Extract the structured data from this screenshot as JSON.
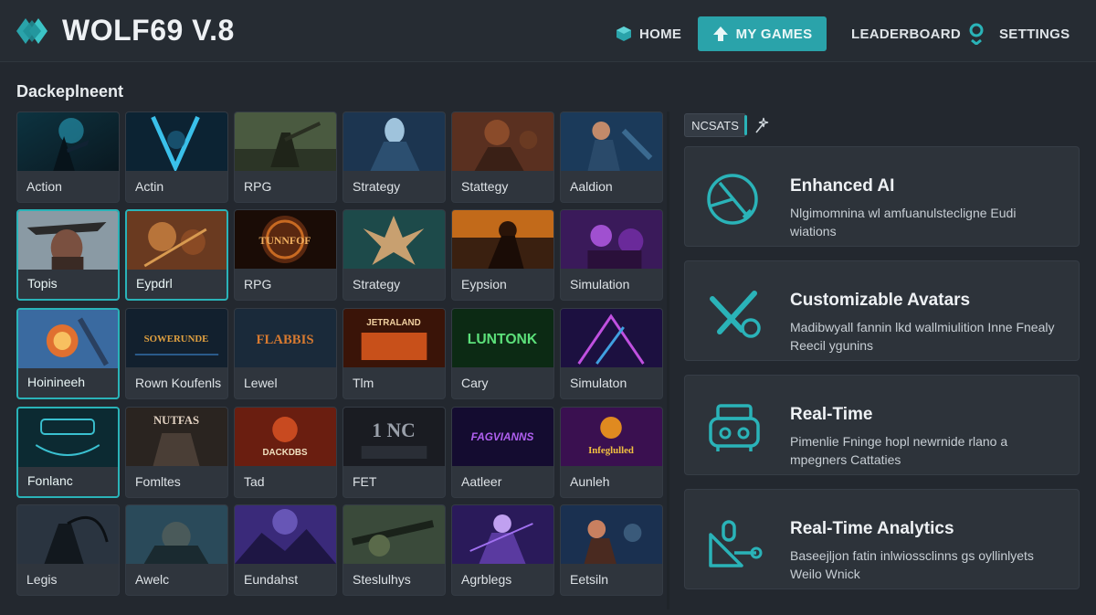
{
  "app": {
    "title": "WOLF69 V.8",
    "accent_color": "#2aa3aa",
    "logo_icon": "diamond-logo-icon"
  },
  "nav": {
    "home": {
      "label": "HOME",
      "icon": "home-box-icon"
    },
    "my_games": {
      "label": "MY GAMES",
      "icon": "arrow-up-icon",
      "active": true
    },
    "leaderboard": {
      "label": "LEADERBOARD"
    },
    "settings": {
      "label": "SETTINGS",
      "icon": "location-pin-icon"
    }
  },
  "section": {
    "title": "Dackeplneent"
  },
  "games": [
    {
      "label": "Action"
    },
    {
      "label": "Actin"
    },
    {
      "label": "RPG"
    },
    {
      "label": "Strategy"
    },
    {
      "label": "Stattegy"
    },
    {
      "label": "Aaldion"
    },
    {
      "label": "Topis",
      "selected": true
    },
    {
      "label": "Eypdrl",
      "selected": true
    },
    {
      "label": "RPG"
    },
    {
      "label": "Strategy"
    },
    {
      "label": "Eypsion"
    },
    {
      "label": "Simulation"
    },
    {
      "label": "Hoinineeh",
      "selected": true
    },
    {
      "label": "Rown Koufenls"
    },
    {
      "label": "Lewel"
    },
    {
      "label": "Tlm"
    },
    {
      "label": "Cary"
    },
    {
      "label": "Simulaton"
    },
    {
      "label": "Fonlanc",
      "selected": true
    },
    {
      "label": "Fomltes"
    },
    {
      "label": "Tad"
    },
    {
      "label": "FET"
    },
    {
      "label": "Aatleer"
    },
    {
      "label": "Aunleh"
    },
    {
      "label": "Legis"
    },
    {
      "label": "Awelc"
    },
    {
      "label": "Eundahst"
    },
    {
      "label": "Steslulhys"
    },
    {
      "label": "Agrblegs"
    },
    {
      "label": "Eetsiln"
    }
  ],
  "thumb_text": {
    "r1c2": "TUNNFOF",
    "r2c1": "SOWERUNDE",
    "r2c2": "FLABBIS",
    "r2c3": "JETRALAND",
    "r2c4": "LUNTONK",
    "r3c1": "NUTFAS",
    "r3c2": "DACKDBS",
    "r3c3": "1 NC",
    "r3c4": "FAGVIANNS",
    "r3c5": "Infeglulled"
  },
  "news": {
    "tag": "NCSATS",
    "action_icon": "magic-wand-icon"
  },
  "features": [
    {
      "title": "Enhanced AI",
      "desc": "Nlgimomnina wl amfuanulstecligne Eudi wiations",
      "icon": "radar-sweep-icon"
    },
    {
      "title": "Customizable Avatars",
      "desc": "Madibwyall fannin lkd wallmiulition Inne Fnealy Reecil ygunins",
      "icon": "crossed-tools-icon"
    },
    {
      "title": "Real-Time",
      "desc": "Pimenlie Fninge hopl newrnide rlano a mpegners Cattaties",
      "icon": "gamepad-icon"
    },
    {
      "title": "Real-Time Analytics",
      "desc": "Baseejljon fatin inlwiossclinns gs oyllinlyets Weilo Wnick",
      "icon": "analytics-link-icon"
    }
  ]
}
